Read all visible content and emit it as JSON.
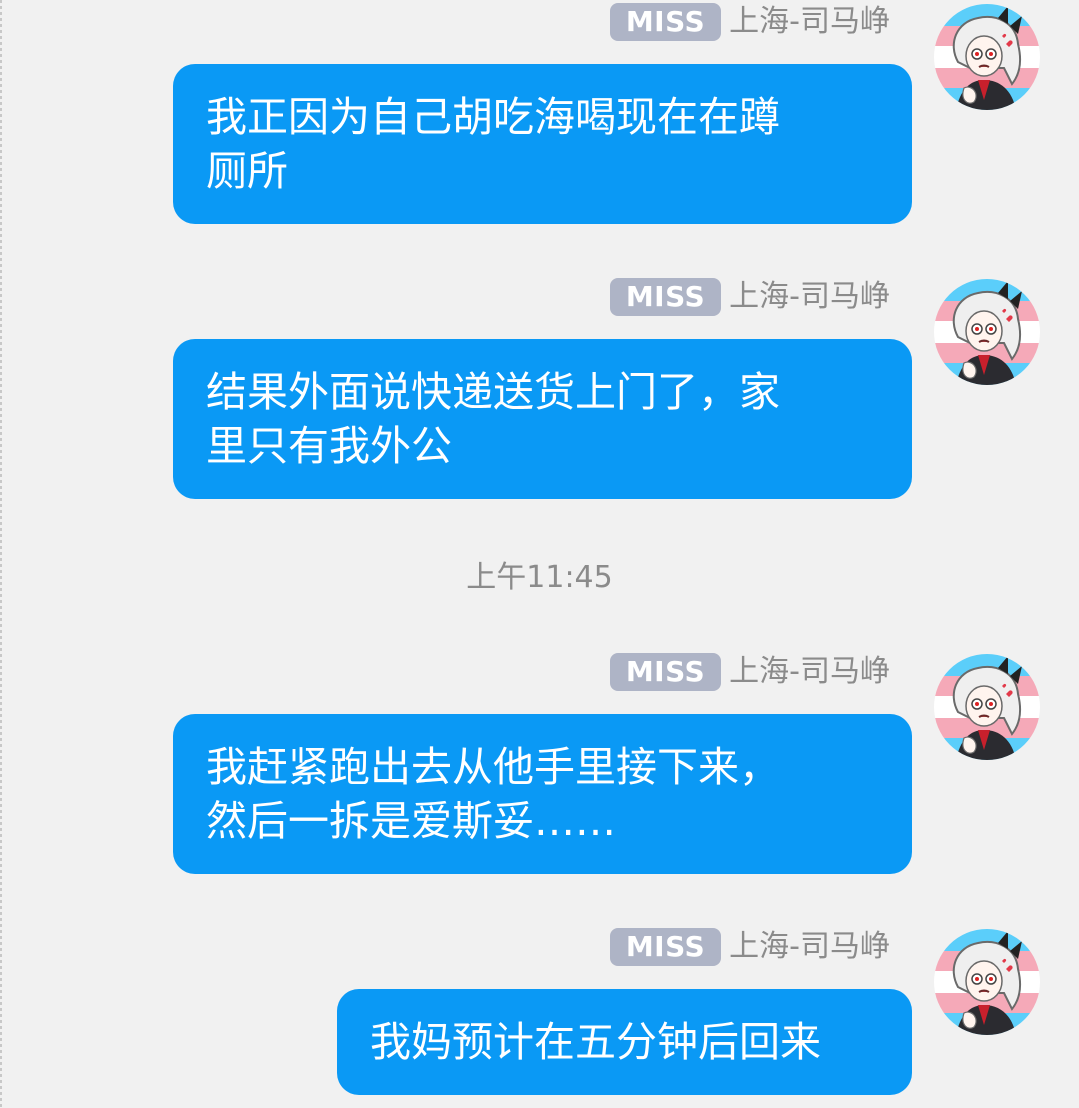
{
  "messages": [
    {
      "badge": "MISS",
      "sender": "上海-司马峥",
      "text": "我正因为自己胡吃海喝现在在蹲\n厕所"
    },
    {
      "badge": "MISS",
      "sender": "上海-司马峥",
      "text": "结果外面说快递送货上门了，家\n里只有我外公"
    },
    {
      "badge": "MISS",
      "sender": "上海-司马峥",
      "text": "我赶紧跑出去从他手里接下来，\n然后一拆是爱斯妥……"
    },
    {
      "badge": "MISS",
      "sender": "上海-司马峥",
      "text": "我妈预计在五分钟后回来"
    }
  ],
  "timestamp": "上午11:45",
  "colors": {
    "background": "#f1f1f1",
    "bubble": "#0a99f5",
    "badge": "#aeb4c6",
    "meta_text": "#8b8b8b",
    "avatar_flag": [
      "#5bcefa",
      "#f5a9b8",
      "#ffffff"
    ]
  },
  "icons": {
    "avatar": "anime-girl-avatar-trans-flag"
  }
}
